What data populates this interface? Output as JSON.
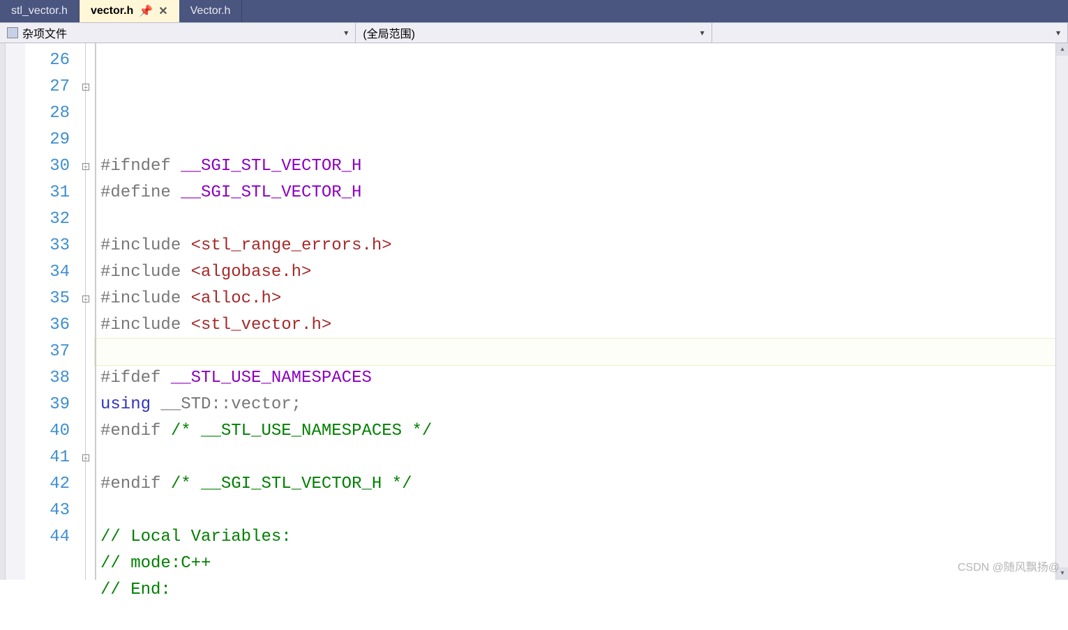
{
  "tabs": [
    {
      "label": "stl_vector.h",
      "active": false
    },
    {
      "label": "vector.h",
      "active": true
    },
    {
      "label": "Vector.h",
      "active": false
    }
  ],
  "toolbar": {
    "combo1": "杂项文件",
    "combo2": "(全局范围)",
    "combo3": ""
  },
  "lineStart": 26,
  "lineEnd": 44,
  "currentLine": 34,
  "code": {
    "l26": "",
    "l27": {
      "pre": "#ifndef ",
      "sym": "__SGI_STL_VECTOR_H"
    },
    "l28": {
      "pre": "#define ",
      "sym": "__SGI_STL_VECTOR_H"
    },
    "l29": "",
    "l30": {
      "pre": "#include ",
      "inc": "<stl_range_errors.h>"
    },
    "l31": {
      "pre": "#include ",
      "inc": "<algobase.h>"
    },
    "l32": {
      "pre": "#include ",
      "inc": "<alloc.h>"
    },
    "l33": {
      "pre": "#include ",
      "inc": "<stl_vector.h>"
    },
    "l34": "",
    "l35": {
      "pre": "#ifdef ",
      "sym": "__STL_USE_NAMESPACES"
    },
    "l36": {
      "kw": "using",
      "rest": " __STD::vector;"
    },
    "l37": {
      "pre": "#endif ",
      "cm": "/* __STL_USE_NAMESPACES */"
    },
    "l38": "",
    "l39": {
      "pre": "#endif ",
      "cm": "/* __SGI_STL_VECTOR_H */"
    },
    "l40": "",
    "l41": {
      "cm": "// Local Variables:"
    },
    "l42": {
      "cm": "// mode:C++"
    },
    "l43": {
      "cm": "// End:"
    },
    "l44": ""
  },
  "outline": {
    "l27": true,
    "l30": true,
    "l35": true,
    "l41": true
  },
  "watermark": "CSDN @随风飘扬@"
}
